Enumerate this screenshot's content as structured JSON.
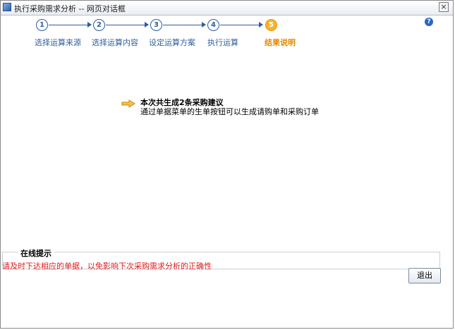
{
  "window": {
    "title": "执行采购需求分析 -- 网页对话框",
    "close_label": "×",
    "help_label": "?"
  },
  "wizard": {
    "steps": [
      {
        "number": "1",
        "label": "选择运算来源"
      },
      {
        "number": "2",
        "label": "选择运算内容"
      },
      {
        "number": "3",
        "label": "设定运算方案"
      },
      {
        "number": "4",
        "label": "执行运算"
      },
      {
        "number": "5",
        "label": "结果说明"
      }
    ],
    "current_step": 5
  },
  "result": {
    "title": "本次共生成2条采购建议",
    "description": "通过单据菜单的生单按钮可以生成请购单和采购订单"
  },
  "tips": {
    "title": "在线提示",
    "text": "请及时下达相应的单据，以免影响下次采购需求分析的正确性"
  },
  "footer": {
    "exit_label": "退出"
  },
  "colors": {
    "step_blue": "#2f5d9f",
    "current_step_orange": "#e48a00",
    "tip_red": "#e01b1b"
  }
}
